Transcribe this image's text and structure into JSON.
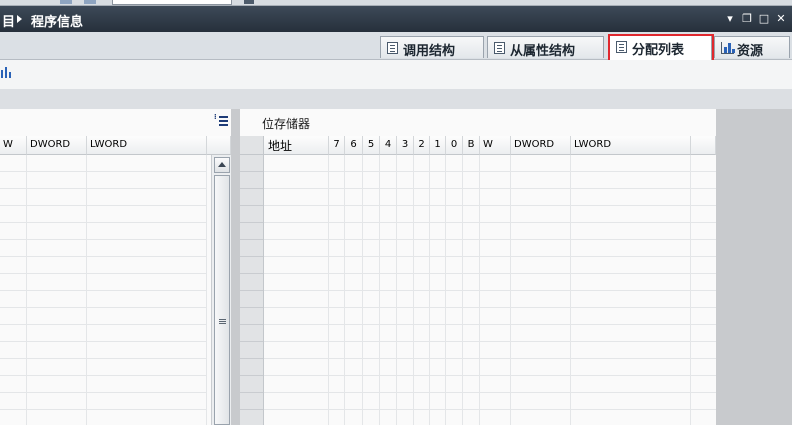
{
  "titlebar": {
    "crumb_tail": "目",
    "title": "程序信息",
    "controls": {
      "pin": "▾",
      "restore": "❐",
      "maximize": "□",
      "close": "✕"
    }
  },
  "tabs": [
    {
      "label": "调用结构",
      "icon": "list-document-icon"
    },
    {
      "label": "从属性结构",
      "icon": "list-document-icon"
    },
    {
      "label": "分配列表",
      "icon": "list-document-icon",
      "active": true
    },
    {
      "label": "资源",
      "icon": "bar-chart-icon"
    }
  ],
  "left_table": {
    "columns": [
      "W",
      "DWORD",
      "LWORD"
    ]
  },
  "right_table": {
    "section_title": "位存储器",
    "columns": [
      "地址",
      "7",
      "6",
      "5",
      "4",
      "3",
      "2",
      "1",
      "0",
      "B",
      "W",
      "DWORD",
      "LWORD"
    ]
  },
  "colors": {
    "highlight": "#e0282e",
    "titlebar": "#2e3946",
    "accent": "#2a62b7"
  }
}
